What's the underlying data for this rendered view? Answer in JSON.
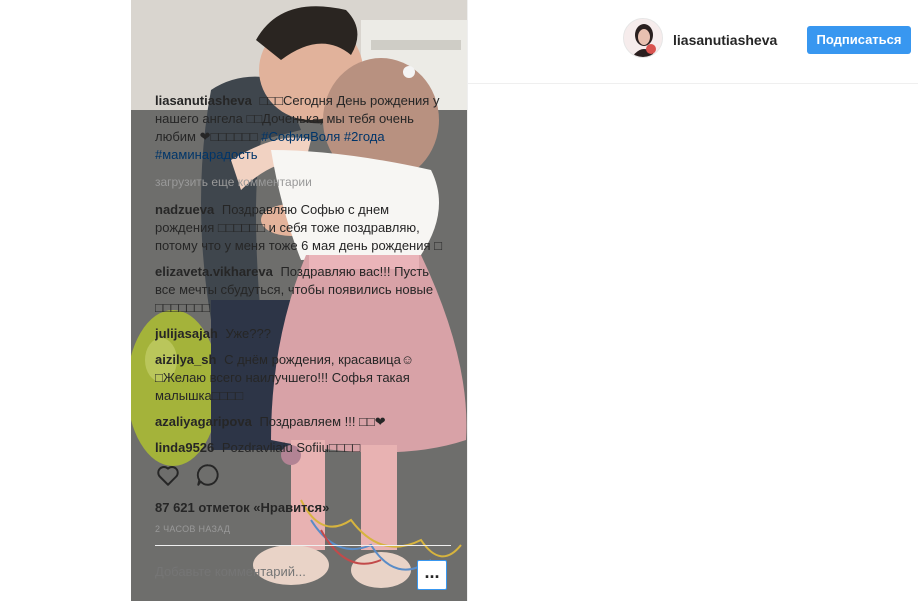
{
  "post": {
    "username": "liasanutiasheva",
    "follow_label": "Подписаться",
    "likes_text": "87 621 отметок «Нравится»",
    "time_text": "2 часов назад",
    "load_more": "загрузить еще комментарии",
    "add_comment_placeholder": "Добавьте комментарий...",
    "more_label": "..."
  },
  "caption": {
    "user": "liasanutiasheva",
    "text": "□□□Сегодня День рождения у нашего ангела □□Доченька, мы тебя очень любим ❤□□□□□□",
    "tags": "#СофияВоля #2года #маминарадость"
  },
  "comments": [
    {
      "user": "nadzueva",
      "text": "Поздравляю Софью с днем рождения □□□□□□ и себя тоже поздравляю, потому что у меня тоже 6 мая день рождения □"
    },
    {
      "user": "elizaveta.vikhareva",
      "text": "Поздравляю вас!!! Пусть все мечты сбудуться, чтобы появились новые □□□□□□□"
    },
    {
      "user": "julijasajah",
      "text": "Уже???"
    },
    {
      "user": "aizilya_sh",
      "text": "С днём рождения, красавица☺□Желаю всего наилучшего!!! Софья такая малышка□□□□"
    },
    {
      "user": "azaliyagaripova",
      "text": "Поздравляем !!! □□❤"
    },
    {
      "user": "linda9526",
      "text": "Pozdravliaiu Sofiiu□□□□"
    }
  ],
  "icons": {
    "like": "heart-outline-icon",
    "comment": "speech-bubble-icon"
  },
  "colors": {
    "accent": "#3897f0",
    "hashtag": "#003569",
    "muted": "#999999"
  }
}
